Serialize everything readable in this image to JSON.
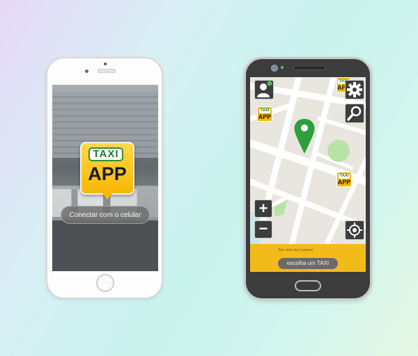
{
  "left_phone": {
    "logo": {
      "tag_text": "TAXI",
      "main_text": "APP"
    },
    "connect_button_label": "Conectar com o celular"
  },
  "right_phone": {
    "map_markers": [
      {
        "tag_text": "TAXI",
        "main_text": "APP"
      },
      {
        "tag_text": "TAXI",
        "main_text": "APP"
      },
      {
        "tag_text": "TAXI",
        "main_text": "APP"
      }
    ],
    "controls": {
      "profile_icon": "person-icon",
      "settings_icon": "gear-icon",
      "search_icon": "magnifier-icon",
      "zoom_in_label": "+",
      "zoom_out_label": "−",
      "locate_icon": "crosshair-icon"
    },
    "address_text": "São José dos Campos",
    "choose_button_label": "escolha um TAXI"
  },
  "colors": {
    "taxi_yellow": "#f7b800",
    "taxi_green": "#1e7d26",
    "bottom_bar": "#f3bb1a",
    "pin_green": "#2e9e3e"
  }
}
